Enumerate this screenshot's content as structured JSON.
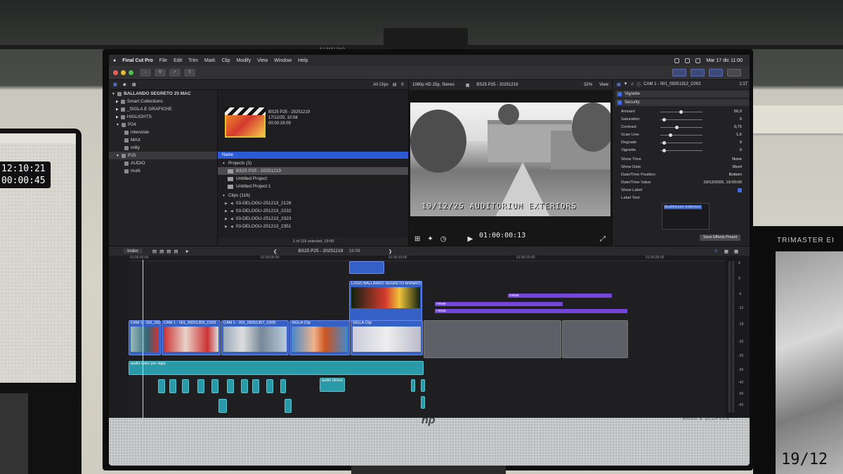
{
  "environment": {
    "tv_brand": "SAMSUNG",
    "laptop_clock": {
      "time": "12:10:21",
      "counter": "00:00:45"
    },
    "right_monitor_label": "TRIMASTER EI",
    "right_monitor_timestamp": "19/12",
    "monitor_brand": "hp",
    "speaker_brand": "BANG & OLUFSEN"
  },
  "menubar": {
    "app": "Final Cut Pro",
    "items": [
      "File",
      "Edit",
      "Trim",
      "Mark",
      "Clip",
      "Modify",
      "View",
      "Window",
      "Help"
    ],
    "clock": "Mar 17 dic  11:00"
  },
  "library": {
    "title": "BALLANDO SEGRETO 25 MAC",
    "items": [
      {
        "label": "Smart Collections",
        "indent": 1
      },
      {
        "label": "_SIGLA E GRAFICHE",
        "indent": 1
      },
      {
        "label": "HIGLIGHTS",
        "indent": 1
      },
      {
        "label": "P24",
        "indent": 1
      },
      {
        "label": "interviste",
        "indent": 2
      },
      {
        "label": "MAX",
        "indent": 2
      },
      {
        "label": "milly",
        "indent": 2
      },
      {
        "label": "P25",
        "indent": 1
      },
      {
        "label": "AUDIO",
        "indent": 2
      },
      {
        "label": "multi",
        "indent": 2
      }
    ]
  },
  "browser": {
    "filter": "All Clips",
    "thumb_title": "BS25 P25 - 20251219",
    "thumb_date": "17/12/25, 10:58",
    "thumb_duration": "00:00:19:09",
    "column_name": "Name",
    "projects_header": "Projects  (3)",
    "projects": [
      "BS25 P25 - 20251219",
      "Untitled Project",
      "Untitled Project 1"
    ],
    "clips_header": "Clips  (116)",
    "clips": [
      "03-DELOGU-251213_2128",
      "03-DELOGU-251213_2232",
      "03-DELOGU-251213_2323",
      "03-DELOGU-251213_2351"
    ],
    "footer": "1 of 119 selected, 19:09"
  },
  "viewer": {
    "format": "1080p HD 25p, Stereo",
    "project": "BS25 P25 - 20251219",
    "zoom": "32%",
    "view_menu": "View",
    "burned_timestamp": "19/12/25   AUDITORIUM EXTERIORS",
    "timecode": "01:00:00:13"
  },
  "inspector": {
    "clip_name": "CAM 1 - 001_09251312_C002",
    "duration": "1:17",
    "effects": [
      "Vignette",
      "Security"
    ],
    "params": [
      {
        "name": "Amount",
        "value": "50,0",
        "knob": 0.45
      },
      {
        "name": "Saturation",
        "value": "0",
        "knob": 0.05
      },
      {
        "name": "Contrast",
        "value": "0,75",
        "knob": 0.35
      },
      {
        "name": "Scan Line",
        "value": "1,5",
        "knob": 0.2
      },
      {
        "name": "Degrade",
        "value": "0",
        "knob": 0.05
      },
      {
        "name": "Vignette",
        "value": "0",
        "knob": 0.05
      }
    ],
    "selects": [
      {
        "name": "Show Time",
        "value": "None"
      },
      {
        "name": "Show Date",
        "value": "Short"
      },
      {
        "name": "Date/Time Position",
        "value": "Bottom"
      },
      {
        "name": "Date/Time Value",
        "value": "19/12/2025, 19:00:00"
      },
      {
        "name": "Show Label",
        "value": ""
      }
    ],
    "label_text_name": "Label Text",
    "label_text_value": "Auditorium exteriors",
    "save_preset": "Save Effects Preset"
  },
  "timeline": {
    "index_label": "Index",
    "project": "BS25 P25 - 20251219",
    "duration": "19:09",
    "ruler": [
      "01:00:00:00",
      "01:00:05:00",
      "01:00:10:00",
      "01:00:15:00",
      "01:00:20:00"
    ],
    "video_clips": [
      "CAM 1 - 001_092...",
      "CAM 1 - 001_09251355_C003",
      "CAM 1 - 001_09251357_C005",
      "SIGLA Clip",
      "SIGLA Clip"
    ],
    "logo_clip": "LOGO BALLANDO SEGRETO ANIMATO",
    "title_clips": [
      "FIRME",
      "FIRME",
      "FIRME"
    ],
    "audio_clip": "audio estro per sigla",
    "audio_clip2": "audio stress",
    "meter_ticks": [
      "6",
      "0",
      "-6",
      "-12",
      "-18",
      "-20",
      "-30",
      "-36",
      "-42",
      "-50",
      "-60"
    ]
  }
}
